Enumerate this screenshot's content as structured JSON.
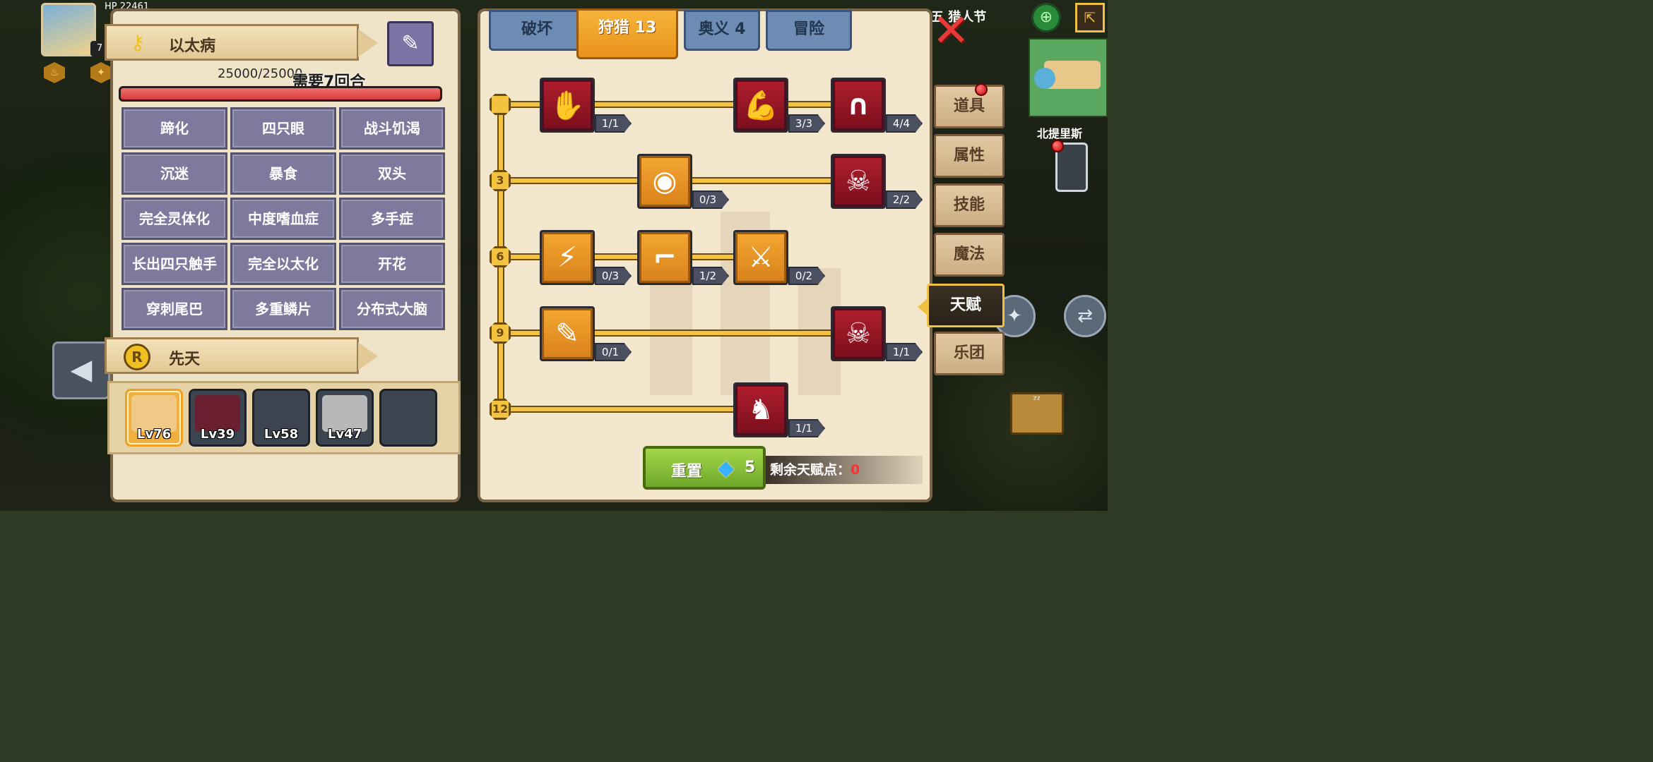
{
  "hud": {
    "hp_label": "HP",
    "hp_value": "22461",
    "level": "7",
    "top_right_text": "安五 猎人节",
    "minimap_label": "北提里斯"
  },
  "disease": {
    "title": "以太病",
    "hp_text": "25000/25000",
    "rounds_text": "需要7回合",
    "hp_fraction": 1.0,
    "traits": [
      "蹄化",
      "四只眼",
      "战斗饥渴",
      "沉迷",
      "暴食",
      "双头",
      "完全灵体化",
      "中度嗜血症",
      "多手症",
      "长出四只触手",
      "完全以太化",
      "开花",
      "穿刺尾巴",
      "多重鳞片",
      "分布式大脑"
    ]
  },
  "innate": {
    "title": "先天",
    "coin_label": "R",
    "party": [
      {
        "level": "Lv76",
        "selected": true,
        "color": "#f1c987"
      },
      {
        "level": "Lv39",
        "selected": false,
        "color": "#6a2030"
      },
      {
        "level": "Lv58",
        "selected": false,
        "color": "#3c4450"
      },
      {
        "level": "Lv47",
        "selected": false,
        "color": "#b8b8b8"
      },
      {
        "level": "",
        "selected": false,
        "color": "#3c4450"
      }
    ]
  },
  "tabs": [
    {
      "label": "破坏",
      "active": false
    },
    {
      "label": "狩猎 13",
      "active": true
    },
    {
      "label": "奥义 4",
      "active": false
    },
    {
      "label": "冒险",
      "active": false
    }
  ],
  "tree": {
    "levels": [
      "",
      "3",
      "6",
      "9",
      "12"
    ],
    "talents": [
      {
        "icon": "claw-hand-icon",
        "glyph": "✋",
        "style": "red",
        "count": "1/1"
      },
      {
        "icon": "muscle-icon",
        "glyph": "💪",
        "style": "red",
        "count": "3/3"
      },
      {
        "icon": "horseshoe-icon",
        "glyph": "∩",
        "style": "red",
        "count": "4/4"
      },
      {
        "icon": "eye-icon",
        "glyph": "◉",
        "style": "orange",
        "count": "0/3"
      },
      {
        "icon": "skull-shield-icon",
        "glyph": "☠",
        "style": "red",
        "count": "2/2"
      },
      {
        "icon": "lightning-arrow-icon",
        "glyph": "⚡",
        "style": "orange",
        "count": "0/3"
      },
      {
        "icon": "winged-boot-icon",
        "glyph": "⌐",
        "style": "orange",
        "count": "1/2"
      },
      {
        "icon": "crossed-swords-icon",
        "glyph": "⚔",
        "style": "orange",
        "count": "0/2"
      },
      {
        "icon": "syringe-icon",
        "glyph": "✎",
        "style": "orange",
        "count": "0/1"
      },
      {
        "icon": "skull-sun-icon",
        "glyph": "☠",
        "style": "red",
        "count": "1/1"
      },
      {
        "icon": "horse-head-icon",
        "glyph": "♞",
        "style": "red",
        "count": "1/1"
      }
    ]
  },
  "footer": {
    "reset_label": "重置",
    "reset_cost": "5",
    "points_label": "剩余天赋点：",
    "points_value": "0"
  },
  "side_menu": [
    {
      "label": "道具",
      "active": false,
      "badge": true
    },
    {
      "label": "属性",
      "active": false,
      "badge": false
    },
    {
      "label": "技能",
      "active": false,
      "badge": false
    },
    {
      "label": "魔法",
      "active": false,
      "badge": false
    },
    {
      "label": "天赋",
      "active": true,
      "badge": false
    },
    {
      "label": "乐团",
      "active": false,
      "badge": false
    }
  ]
}
